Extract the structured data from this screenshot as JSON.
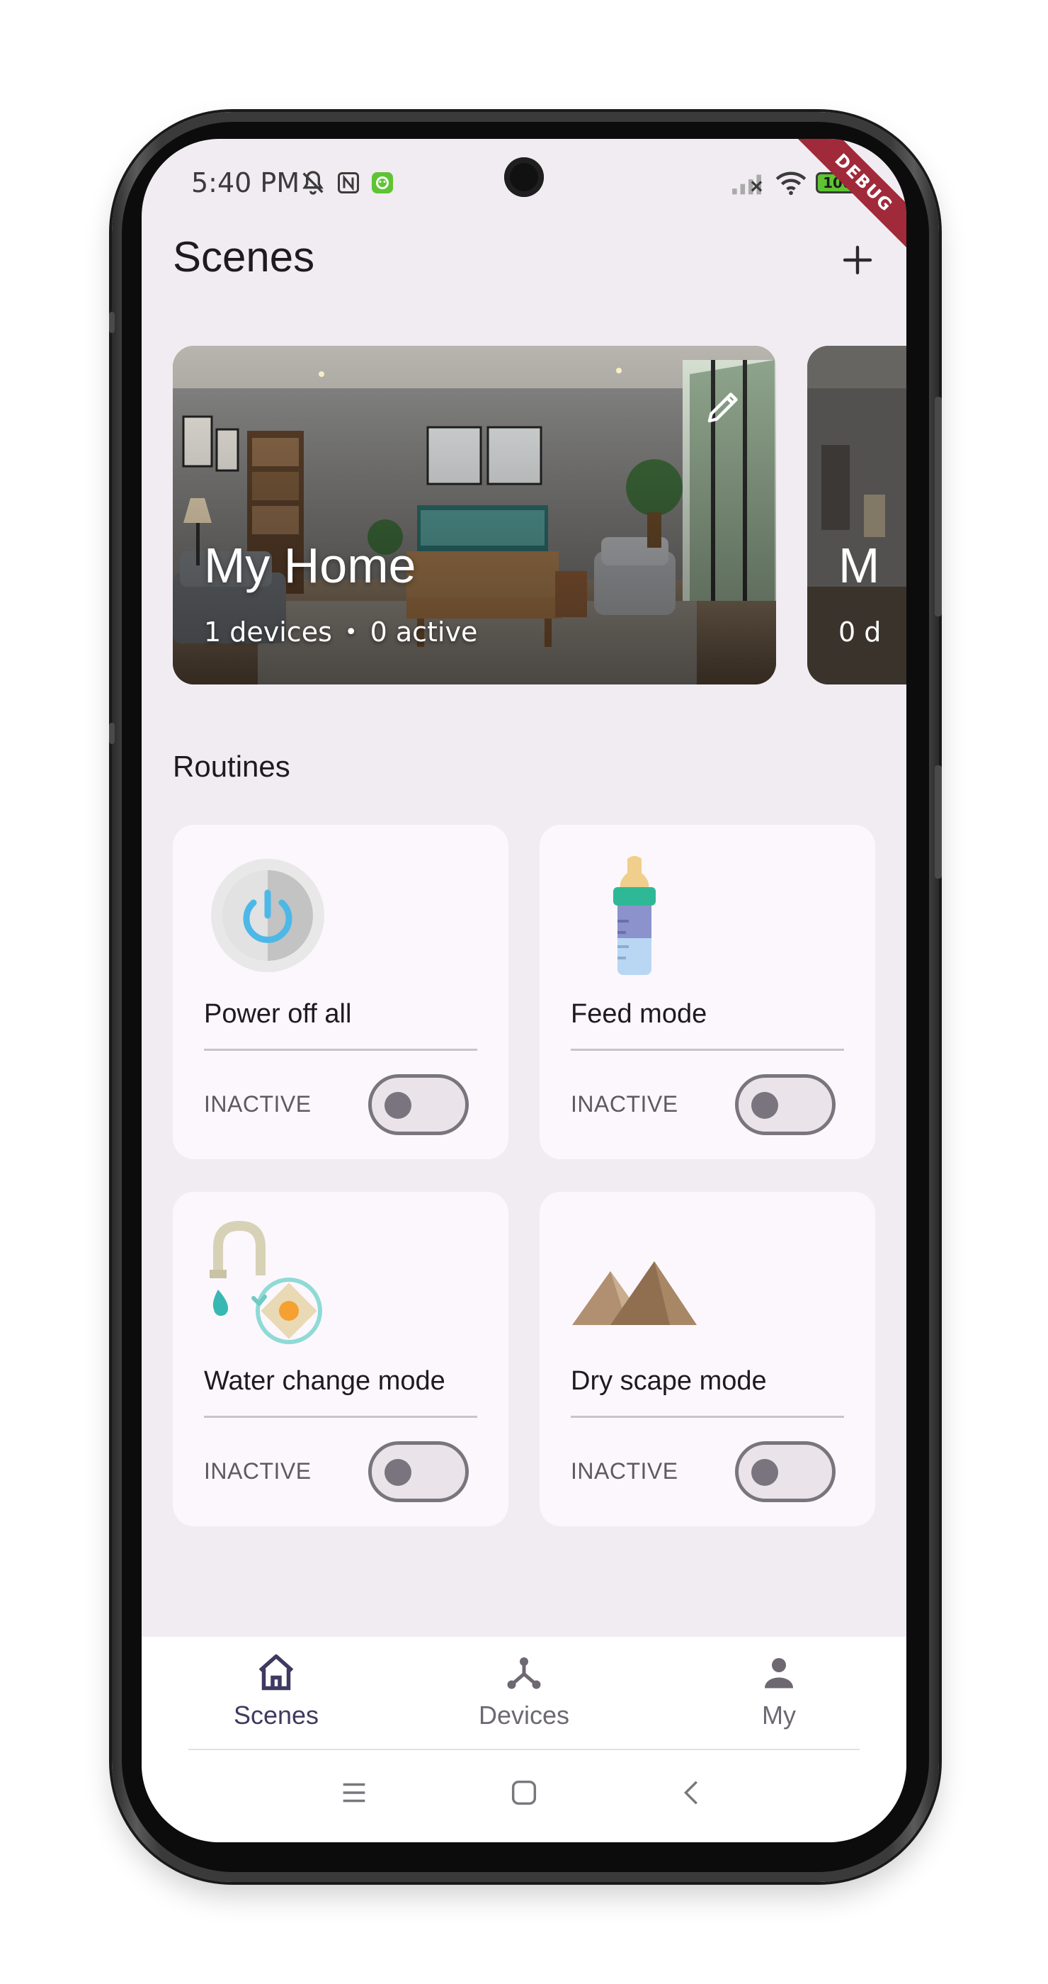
{
  "status_bar": {
    "time": "5:40 PM",
    "battery": "100",
    "debug_label": "DEBUG"
  },
  "header": {
    "title": "Scenes",
    "add_icon": "plus-icon"
  },
  "scenes": [
    {
      "name": "My Home",
      "devices": "1 devices",
      "active": "0 active"
    },
    {
      "name": "M",
      "devices": "0 d"
    }
  ],
  "routines": {
    "title": "Routines",
    "items": [
      {
        "name": "Power off all",
        "status": "INACTIVE",
        "icon": "power-icon",
        "enabled": false
      },
      {
        "name": "Feed mode",
        "status": "INACTIVE",
        "icon": "baby-bottle-icon",
        "enabled": false
      },
      {
        "name": "Water change mode",
        "status": "INACTIVE",
        "icon": "faucet-icon",
        "enabled": false
      },
      {
        "name": "Dry scape mode",
        "status": "INACTIVE",
        "icon": "mountains-icon",
        "enabled": false
      }
    ]
  },
  "bottom_nav": {
    "items": [
      {
        "label": "Scenes",
        "icon": "home-icon",
        "active": true
      },
      {
        "label": "Devices",
        "icon": "devices-icon",
        "active": false
      },
      {
        "label": "My",
        "icon": "person-icon",
        "active": false
      }
    ]
  },
  "colors": {
    "background": "#f1ecf1",
    "card": "#fcf7fc",
    "accent": "#3f3a60",
    "toggle_outline": "#79747e"
  }
}
